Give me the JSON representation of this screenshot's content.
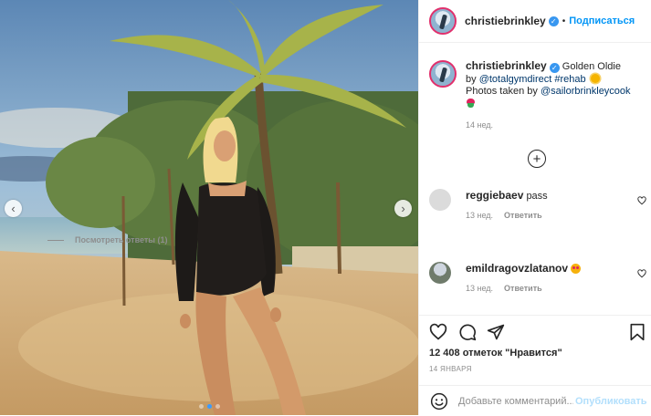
{
  "post": {
    "username": "christiebrinkley",
    "follow_label": "Подписаться",
    "separator": "•"
  },
  "caption": {
    "username": "christiebrinkley",
    "text_1": "Golden Oldie",
    "text_by": "by",
    "mention_1": "@totalgymdirect",
    "hashtag": "#rehab",
    "text_photos": "Photos taken by",
    "mention_2": "@sailorbrinkleycook",
    "time": "14 нед."
  },
  "comments": [
    {
      "username": "reggiebaev",
      "text": "pass",
      "time": "13 нед.",
      "reply_label": "Ответить"
    },
    {
      "username": "emildragovzlatanov",
      "text": "",
      "time": "13 нед.",
      "reply_label": "Ответить"
    }
  ],
  "view_replies": "Посмотреть ответы (1)",
  "likes": "12 408 отметок \"Нравится\"",
  "date": "14 ЯНВАРЯ",
  "comment_box": {
    "placeholder": "Добавьте комментарий...",
    "publish_label": "Опубликовать"
  },
  "icons": {
    "verified": "verified-badge-icon",
    "prev": "chevron-left-icon",
    "next": "chevron-right-icon",
    "load_more": "plus-circle-icon",
    "like": "heart-icon",
    "comment": "comment-icon",
    "share": "paper-plane-icon",
    "save": "bookmark-icon",
    "emoji": "smile-icon"
  },
  "carousel": {
    "slides": 3,
    "active_index": 1
  },
  "colors": {
    "accent": "#0095f6",
    "verified": "#3897f0",
    "publish_disabled": "#b2dffc"
  }
}
